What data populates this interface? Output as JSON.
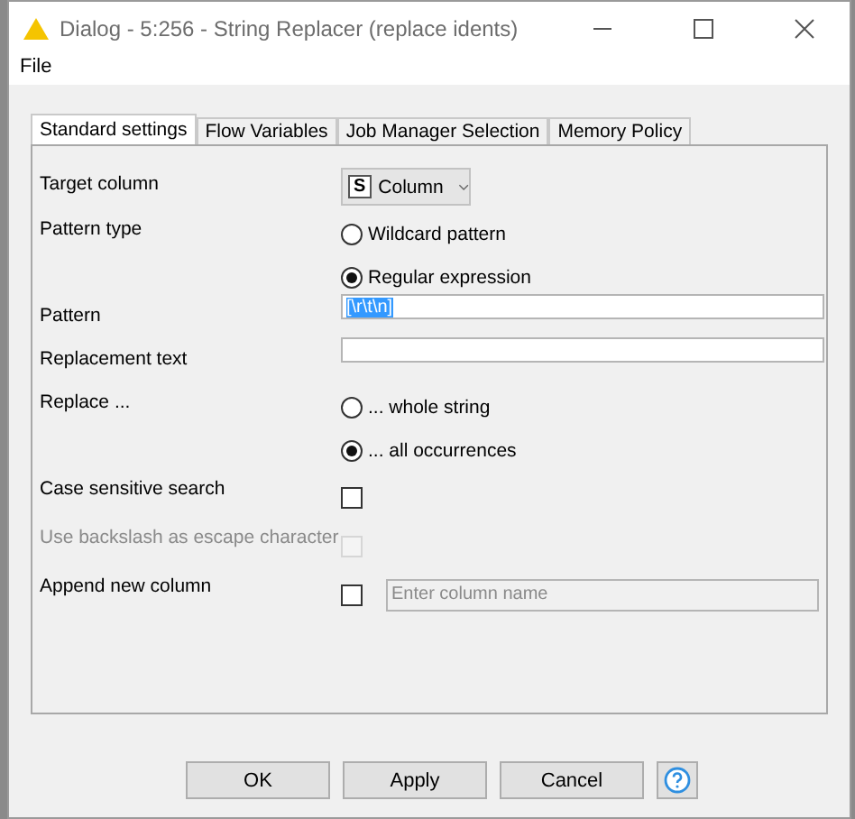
{
  "window": {
    "title": "Dialog - 5:256 - String Replacer (replace idents)"
  },
  "menu": [
    "File"
  ],
  "tabs": [
    {
      "label": "Standard settings",
      "selected": true
    },
    {
      "label": "Flow Variables",
      "selected": false
    },
    {
      "label": "Job Manager Selection",
      "selected": false
    },
    {
      "label": "Memory Policy",
      "selected": false
    }
  ],
  "settings": [
    {
      "kind": "dropdown",
      "label": "Target column",
      "type_badge": "S",
      "value": "Column"
    },
    {
      "kind": "radio",
      "label": "Pattern type",
      "options": [
        {
          "label": "Wildcard pattern",
          "selected": false
        },
        {
          "label": "Regular expression",
          "selected": true
        }
      ]
    },
    {
      "kind": "text",
      "label": "Pattern",
      "value": "[\\r\\t\\n]",
      "highlighted": true
    },
    {
      "kind": "text",
      "label": "Replacement text"
    },
    {
      "kind": "radio",
      "label": "Replace ...",
      "options": [
        {
          "label": "... whole string",
          "selected": false
        },
        {
          "label": "... all occurrences",
          "selected": true
        }
      ]
    },
    {
      "kind": "checkbox",
      "label": "Case sensitive search",
      "checked": false,
      "disabled": false
    },
    {
      "kind": "checkbox",
      "label": "Use backslash as escape character",
      "checked": false,
      "disabled": true
    },
    {
      "kind": "checkbox_text",
      "label": "Append new column",
      "checked": false,
      "disabled": false,
      "placeholder": "Enter column name"
    }
  ],
  "buttons": [
    {
      "kind": "text",
      "label": "OK"
    },
    {
      "kind": "text",
      "label": "Apply"
    },
    {
      "kind": "text",
      "label": "Cancel"
    },
    {
      "kind": "help"
    }
  ]
}
